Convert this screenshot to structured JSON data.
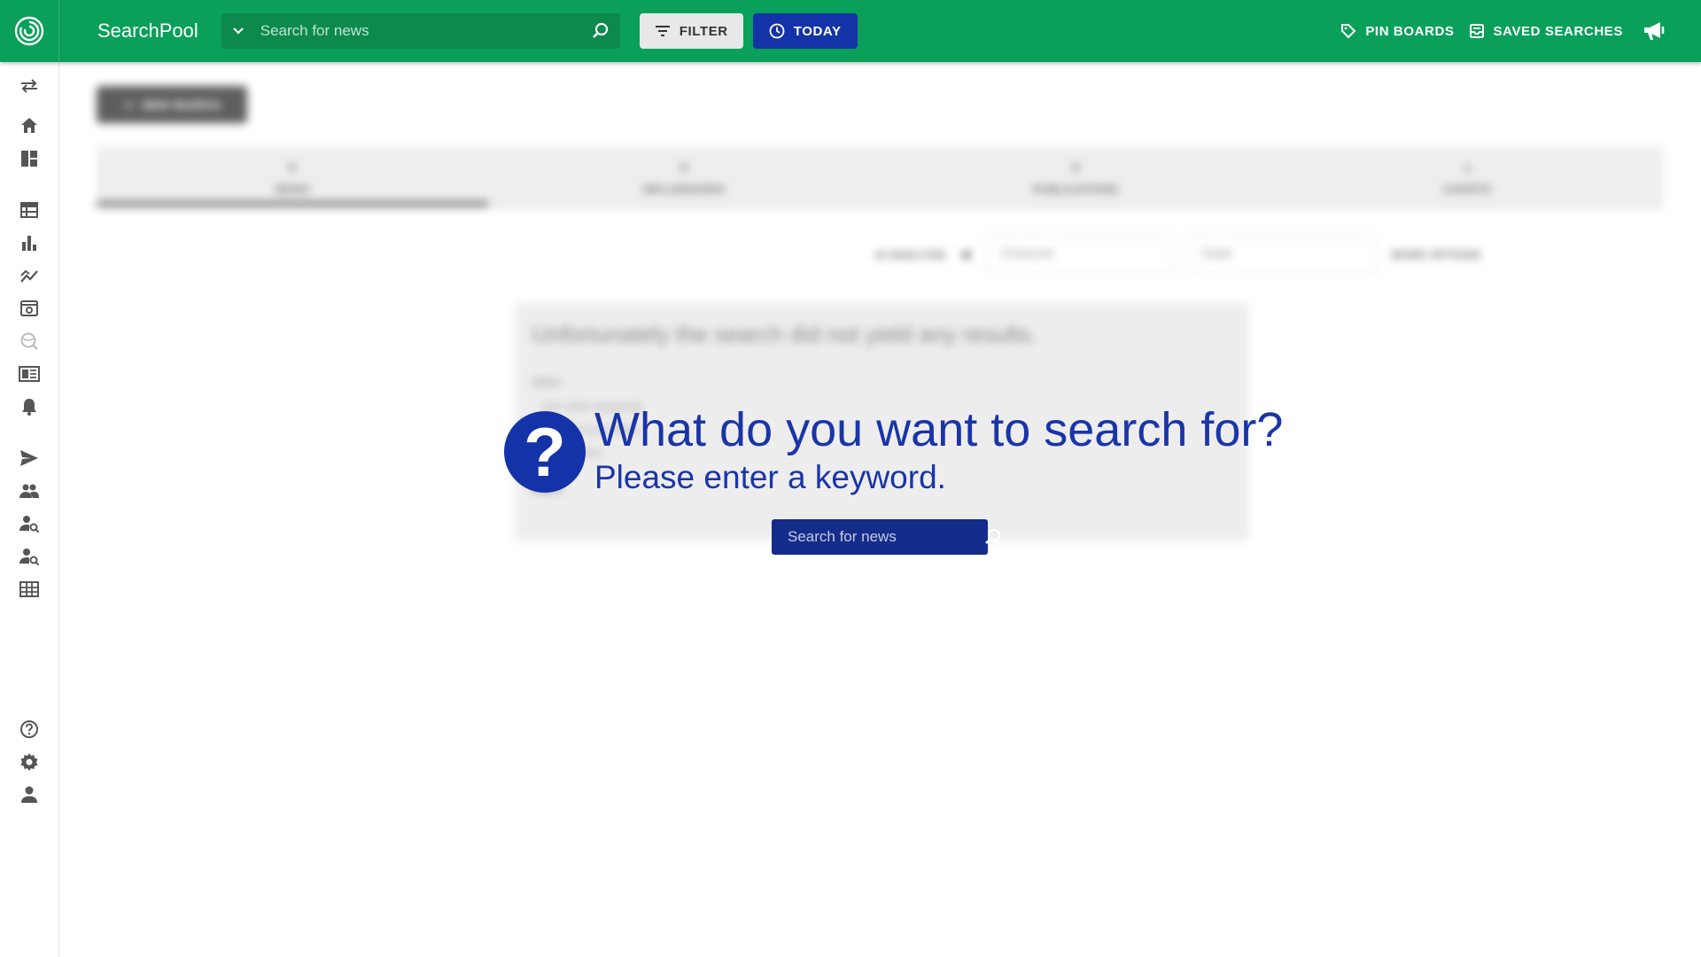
{
  "header": {
    "brand": "SearchPool",
    "search_placeholder": "Search for news",
    "filter_label": "FILTER",
    "today_label": "TODAY",
    "pin_boards_label": "PIN BOARDS",
    "saved_searches_label": "SAVED SEARCHES"
  },
  "sidebar": {
    "icons": [
      "swap-icon",
      "home-icon",
      "dashboard-icon",
      "calendar-table-icon",
      "bar-chart-icon",
      "line-chart-icon",
      "monitor-icon",
      "globe-search-icon",
      "newspaper-icon",
      "bell-icon",
      "send-icon",
      "people-icon",
      "person-search-icon",
      "person-search-icon",
      "grid-icon",
      "help-icon",
      "settings-icon",
      "user-icon"
    ]
  },
  "background": {
    "new_search_label": "NEW SEARCH",
    "tabs": [
      {
        "count": "0",
        "label": "NEWS"
      },
      {
        "count": "0",
        "label": "INFLUENCERS"
      },
      {
        "count": "0",
        "label": "PUBLICATIONS"
      },
      {
        "count": "",
        "label": "CHARTS"
      }
    ],
    "toolbar": {
      "ai_label": "AI ANALYSIS",
      "group_label": "Channel",
      "sort_label": "Date",
      "more_label": "MORE OPTIONS"
    },
    "no_results": "Unfortunately the search did not yield any results.",
    "hint_title": "Ideas",
    "suggestions": [
      "Use other keywords",
      "Broaden your filters",
      "Reset filters"
    ],
    "help_label": "HELP"
  },
  "prompt": {
    "icon_glyph": "?",
    "title": "What do you want to search for?",
    "subtitle": "Please enter a keyword.",
    "search_placeholder": "Search for news"
  },
  "colors": {
    "topbar": "#0aa05a",
    "accent_blue": "#1433a8"
  }
}
